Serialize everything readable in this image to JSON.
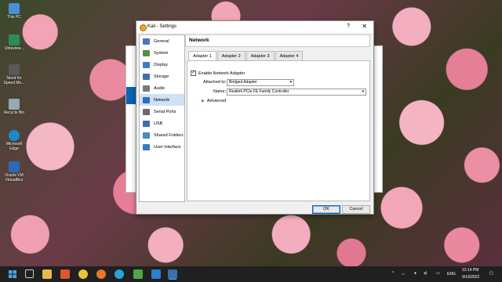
{
  "desktop": {
    "icons": [
      {
        "label": "This PC",
        "color": "#4a90d9"
      },
      {
        "label": "Ultraview...",
        "color": "#2e8b57"
      },
      {
        "label": "Need for Speed Mo...",
        "color": "#5a5a5a"
      },
      {
        "label": "Recycle Bin",
        "color": "#9aa7b5"
      },
      {
        "label": "Microsoft Edge",
        "color": "#1e88c8"
      },
      {
        "label": "Oracle VM VirtualBox",
        "color": "#2b6cb0"
      }
    ]
  },
  "dialog": {
    "title": "Kali - Settings",
    "help_label": "?",
    "close_label": "✕",
    "nav": [
      {
        "label": "General",
        "icon_color": "#4a78b8",
        "icon": "general-icon"
      },
      {
        "label": "System",
        "icon_color": "#5d8a4a",
        "icon": "system-icon"
      },
      {
        "label": "Display",
        "icon_color": "#3a7fc8",
        "icon": "display-icon"
      },
      {
        "label": "Storage",
        "icon_color": "#3f6fae",
        "icon": "storage-icon"
      },
      {
        "label": "Audio",
        "icon_color": "#7a7a7a",
        "icon": "audio-icon"
      },
      {
        "label": "Network",
        "icon_color": "#2c6fbf",
        "icon": "network-icon"
      },
      {
        "label": "Serial Ports",
        "icon_color": "#6a6a6a",
        "icon": "serial-ports-icon"
      },
      {
        "label": "USB",
        "icon_color": "#3c6eb0",
        "icon": "usb-icon"
      },
      {
        "label": "Shared Folders",
        "icon_color": "#4a88c8",
        "icon": "shared-folders-icon"
      },
      {
        "label": "User Interface",
        "icon_color": "#3a78c0",
        "icon": "user-interface-icon"
      }
    ],
    "selected_nav": "Network",
    "heading": "Network",
    "tabs": [
      "Adapter 1",
      "Adapter 2",
      "Adapter 3",
      "Adapter 4"
    ],
    "active_tab": "Adapter 1",
    "enable_label": "Enable Network Adapter",
    "enable_checked": true,
    "attached_label": "Attached to:",
    "attached_value": "Bridged Adapter",
    "name_label": "Name:",
    "name_value": "Realtek PCIe FE Family Controller",
    "advanced_label": "Advanced",
    "ok_label": "OK",
    "cancel_label": "Cancel"
  },
  "taskbar": {
    "time": "12:14 PM",
    "date": "9/19/2022",
    "language": "ENG",
    "apps": [
      {
        "name": "start",
        "color": "#4aa3e8"
      },
      {
        "name": "task-view",
        "color": "#cccccc"
      },
      {
        "name": "file-explorer",
        "color": "#e8b84a"
      },
      {
        "name": "brave",
        "color": "#e0562a"
      },
      {
        "name": "chrome",
        "color": "#e8c23a"
      },
      {
        "name": "firefox",
        "color": "#e87a2a"
      },
      {
        "name": "telegram",
        "color": "#2ea0dc"
      },
      {
        "name": "utorrent",
        "color": "#4fa54a"
      },
      {
        "name": "vscode",
        "color": "#2a7fd0"
      },
      {
        "name": "virtualbox",
        "color": "#3a6fb0"
      }
    ]
  }
}
